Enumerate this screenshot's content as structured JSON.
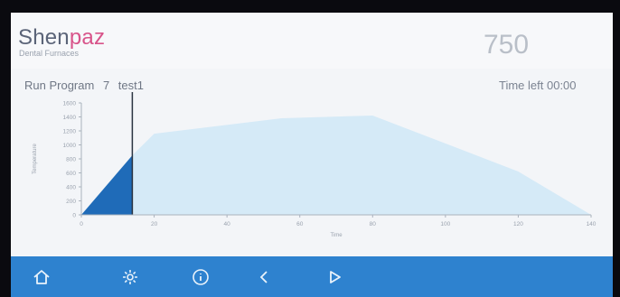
{
  "header": {
    "brand_main": "Shen",
    "brand_accent": "paz",
    "brand_subtitle": "Dental Furnaces",
    "current_temperature": "750"
  },
  "program": {
    "label": "Run Program",
    "number": "7",
    "name": "test1",
    "time_left_label": "Time left",
    "time_left_value": "00:00"
  },
  "colors": {
    "nav_bar": "#2e82cf",
    "planned_profile": "#cfe8f7",
    "progress_fill": "#1f6bb8",
    "brand_accent": "#d8548a"
  },
  "navbar": {
    "items": [
      {
        "name": "home-icon"
      },
      {
        "name": "settings-icon"
      },
      {
        "name": "info-icon"
      },
      {
        "name": "back-icon"
      },
      {
        "name": "play-icon"
      }
    ]
  },
  "chart_data": {
    "type": "area",
    "xlabel": "Time",
    "ylabel": "Temperature",
    "x_ticks": [
      "0",
      "20",
      "40",
      "60",
      "80",
      "100",
      "120",
      "140"
    ],
    "y_ticks": [
      "0",
      "200",
      "400",
      "600",
      "800",
      "1000",
      "1200",
      "1400",
      "1600"
    ],
    "xlim": [
      0,
      140
    ],
    "ylim": [
      0,
      1600
    ],
    "series": [
      {
        "x": [
          0,
          14,
          20,
          55,
          80,
          120,
          140
        ],
        "y": [
          0,
          850,
          1160,
          1380,
          1420,
          620,
          0
        ]
      }
    ],
    "progress": {
      "x": [
        0,
        14
      ],
      "y": [
        0,
        850
      ]
    },
    "cursor_x": 14
  }
}
